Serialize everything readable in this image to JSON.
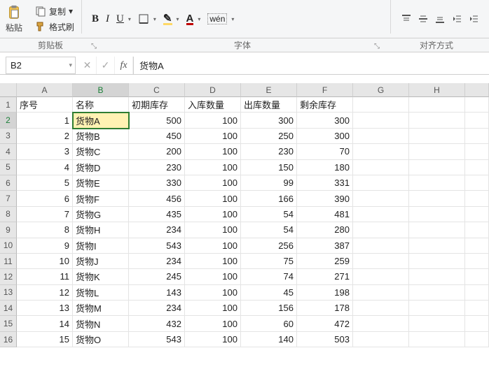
{
  "ribbon": {
    "paste_label": "粘贴",
    "copy_label": "复制",
    "format_painter_label": "格式刷",
    "group_clipboard": "剪贴板",
    "group_font": "字体",
    "group_align": "对齐方式",
    "bold": "B",
    "italic": "I",
    "underline": "U",
    "wen": "wén",
    "A": "A"
  },
  "formula": {
    "namebox": "B2",
    "cancel": "✕",
    "confirm": "✓",
    "fx": "fx",
    "value": "货物A"
  },
  "columns": [
    "A",
    "B",
    "C",
    "D",
    "E",
    "F",
    "G",
    "H"
  ],
  "active": {
    "col": 1,
    "row": 1
  },
  "headers": [
    "序号",
    "名称",
    "初期库存",
    "入库数量",
    "出库数量",
    "剩余库存"
  ],
  "rows": [
    {
      "n": 1,
      "name": "货物A",
      "init": 500,
      "in": 100,
      "out": 300,
      "rem": 300
    },
    {
      "n": 2,
      "name": "货物B",
      "init": 450,
      "in": 100,
      "out": 250,
      "rem": 300
    },
    {
      "n": 3,
      "name": "货物C",
      "init": 200,
      "in": 100,
      "out": 230,
      "rem": 70
    },
    {
      "n": 4,
      "name": "货物D",
      "init": 230,
      "in": 100,
      "out": 150,
      "rem": 180
    },
    {
      "n": 5,
      "name": "货物E",
      "init": 330,
      "in": 100,
      "out": 99,
      "rem": 331
    },
    {
      "n": 6,
      "name": "货物F",
      "init": 456,
      "in": 100,
      "out": 166,
      "rem": 390
    },
    {
      "n": 7,
      "name": "货物G",
      "init": 435,
      "in": 100,
      "out": 54,
      "rem": 481
    },
    {
      "n": 8,
      "name": "货物H",
      "init": 234,
      "in": 100,
      "out": 54,
      "rem": 280
    },
    {
      "n": 9,
      "name": "货物I",
      "init": 543,
      "in": 100,
      "out": 256,
      "rem": 387
    },
    {
      "n": 10,
      "name": "货物J",
      "init": 234,
      "in": 100,
      "out": 75,
      "rem": 259
    },
    {
      "n": 11,
      "name": "货物K",
      "init": 245,
      "in": 100,
      "out": 74,
      "rem": 271
    },
    {
      "n": 12,
      "name": "货物L",
      "init": 143,
      "in": 100,
      "out": 45,
      "rem": 198
    },
    {
      "n": 13,
      "name": "货物M",
      "init": 234,
      "in": 100,
      "out": 156,
      "rem": 178
    },
    {
      "n": 14,
      "name": "货物N",
      "init": 432,
      "in": 100,
      "out": 60,
      "rem": 472
    },
    {
      "n": 15,
      "name": "货物O",
      "init": 543,
      "in": 100,
      "out": 140,
      "rem": 503
    }
  ]
}
